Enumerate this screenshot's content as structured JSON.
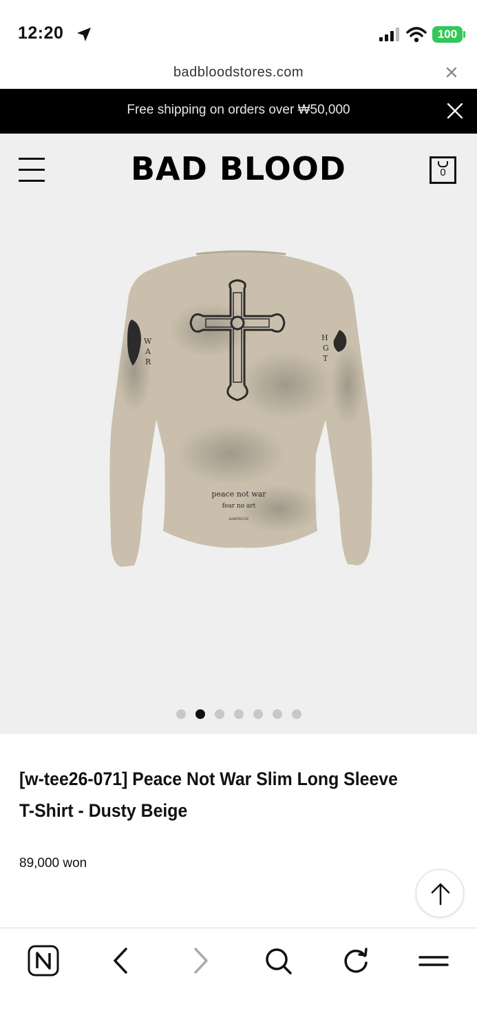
{
  "status_bar": {
    "time": "12:20",
    "battery": "100"
  },
  "browser": {
    "url": "badbloodstores.com"
  },
  "promo": {
    "text": "Free shipping on orders over ₩50,000"
  },
  "header": {
    "logo": "BAD BLOOD",
    "cart_count": "0"
  },
  "gallery": {
    "slide_count": 7,
    "active_index": 1,
    "image_text": [
      "peace not war",
      "fear no art",
      "BABYBLUE"
    ]
  },
  "product": {
    "title": "[w-tee26-071] Peace Not War Slim Long Sleeve T-Shirt - Dusty Beige",
    "price": "89,000 won"
  },
  "colors": {
    "promo_bg": "#000000",
    "hero_bg": "#efefef",
    "battery": "#34c759",
    "shirt": "#c9bfac"
  },
  "icons": [
    "location-arrow-icon",
    "signal-icon",
    "wifi-icon",
    "close-icon",
    "menu-icon",
    "cart-icon",
    "arrow-up-icon",
    "naver-icon",
    "back-icon",
    "forward-icon",
    "search-icon",
    "refresh-icon",
    "hamburger-icon"
  ]
}
